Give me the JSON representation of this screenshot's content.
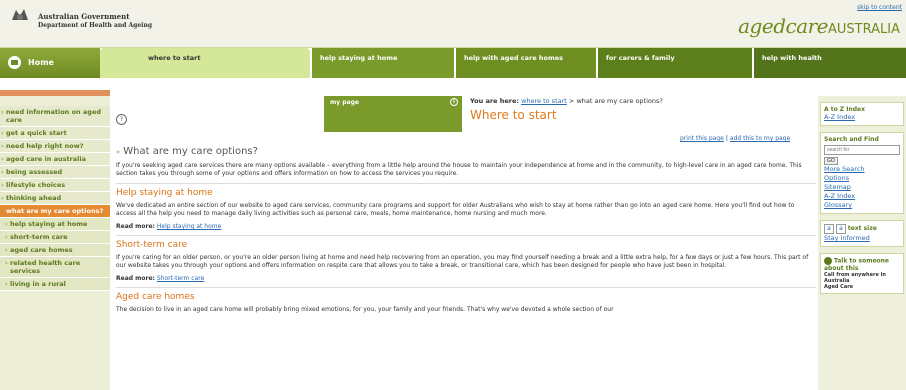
{
  "header": {
    "gov_line1": "Australian Government",
    "gov_line2": "Department of Health and Ageing",
    "logo_script": "agedcare",
    "logo_caps": "AUSTRALIA",
    "skip_link": "skip to content"
  },
  "nav": {
    "home": "Home",
    "tabs": [
      "where to start",
      "help staying at home",
      "help with aged care homes",
      "for carers & family",
      "help with health"
    ]
  },
  "sidebar": {
    "items": [
      "need information on aged care",
      "get a quick start",
      "need help right now?",
      "aged care in australia",
      "being assessed",
      "lifestyle choices",
      "thinking ahead",
      "what are my care options?",
      "help staying at home",
      "short-term care",
      "aged care homes",
      "related health care services",
      "living in a rural"
    ]
  },
  "mypage": {
    "label": "my page",
    "icon": "info-icon"
  },
  "breadcrumb": {
    "prefix": "You are here:",
    "link": "where to start",
    "sep": ">",
    "current": "what are my care options?"
  },
  "page_title": "Where to start",
  "page_tools": {
    "print": "print this page",
    "sep": "|",
    "add": "add this to my page"
  },
  "content": {
    "heading": "What are my care options?",
    "intro": "If you're seeking aged care services there are many options available – everything from a little help around the house to maintain your independence at home and in the community, to high-level care in an aged care home. This section takes you through some of your options and offers information on how to access the services you require.",
    "sections": [
      {
        "title": "Help staying at home",
        "body": "We've dedicated an entire section of our website to aged care services, community care programs and support for older Australians who wish to stay at home rather than go into an aged care home. Here you'll find out how to access all the help you need to manage daily living activities such as personal care, meals, home maintenance, home nursing and much more.",
        "read_more_label": "Read more:",
        "read_more_link": "Help staying at home"
      },
      {
        "title": "Short-term care",
        "body": "If you're caring for an older person, or you're an older person living at home and need help recovering from an operation, you may find yourself needing a break and a little extra help, for a few days or just a few hours. This part of our website takes you through your options and offers information on respite care that allows you to take a break, or transitional care, which has been designed for people who have just been in hospital.",
        "read_more_label": "Read more:",
        "read_more_link": "Short-term care"
      },
      {
        "title": "Aged care homes",
        "body": "The decision to live in an aged care home will probably bring mixed emotions, for you, your family and your friends. That's why we've devoted a whole section of our"
      }
    ]
  },
  "right": {
    "az_title": "A to Z Index",
    "az_link": "A-Z Index",
    "search_title": "Search and Find",
    "search_placeholder": "search for",
    "go": "GO",
    "links": [
      "More Search",
      "Options",
      "Sitemap",
      "A-Z Index",
      "Glossary"
    ],
    "text_size_small": "a",
    "text_size_large": "a",
    "text_size_label": "text size",
    "stay_informed": "Stay informed",
    "talk_title": "Talk to someone about this",
    "call_line": "Call from anywhere in Australia",
    "aged_care_line": "Aged Care"
  }
}
